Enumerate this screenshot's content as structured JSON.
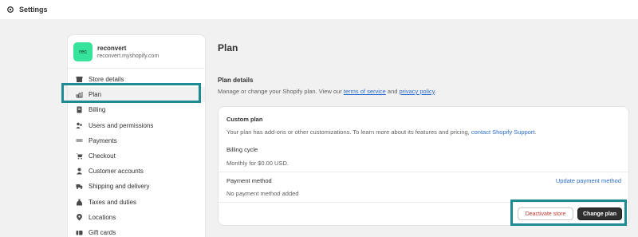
{
  "topbar": {
    "title": "Settings"
  },
  "store": {
    "avatar_text": "rec",
    "name": "reconvert",
    "domain": "reconvert.myshopify.com"
  },
  "sidebar": {
    "items": [
      {
        "label": "Store details",
        "icon": "store-icon"
      },
      {
        "label": "Plan",
        "icon": "plan-chart-icon",
        "active": true
      },
      {
        "label": "Billing",
        "icon": "billing-icon"
      },
      {
        "label": "Users and permissions",
        "icon": "users-icon"
      },
      {
        "label": "Payments",
        "icon": "payments-icon"
      },
      {
        "label": "Checkout",
        "icon": "cart-icon"
      },
      {
        "label": "Customer accounts",
        "icon": "person-icon"
      },
      {
        "label": "Shipping and delivery",
        "icon": "truck-icon"
      },
      {
        "label": "Taxes and duties",
        "icon": "money-bag-icon"
      },
      {
        "label": "Locations",
        "icon": "location-pin-icon"
      },
      {
        "label": "Gift cards",
        "icon": "gift-card-icon"
      }
    ]
  },
  "main": {
    "title": "Plan",
    "details_title": "Plan details",
    "details_desc_prefix": "Manage or change your Shopify plan. View our ",
    "terms_link": "terms of service",
    "and_text": " and ",
    "privacy_link": "privacy policy",
    "period": "."
  },
  "card": {
    "custom_plan_title": "Custom plan",
    "custom_plan_text": "Your plan has add-ons or other customizations. To learn more about its features and pricing, ",
    "support_link": "contact Shopify Support",
    "support_period": ".",
    "billing_cycle_title": "Billing cycle",
    "billing_cycle_text": "Monthly for $0.00 USD.",
    "payment_method_title": "Payment method",
    "payment_method_text": "No payment method added",
    "update_payment_link": "Update payment method",
    "deactivate_label": "Deactivate store",
    "change_plan_label": "Change plan"
  },
  "colors": {
    "accent_highlight": "#1e8a93",
    "link": "#2c6ecb",
    "avatar_bg": "#36e39b",
    "primary_button": "#303030",
    "danger_text": "#c2362f"
  }
}
